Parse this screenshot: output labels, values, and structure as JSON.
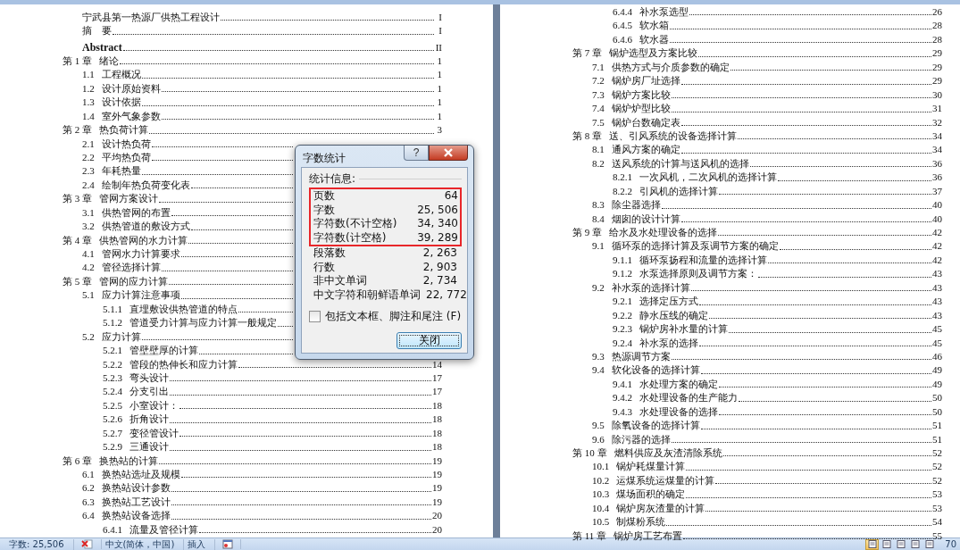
{
  "pages": [
    {
      "entries": [
        {
          "kind": "front",
          "title": "宁武县第一热源厂供热工程设计",
          "page": "I"
        },
        {
          "kind": "front",
          "title": "摘　要",
          "page": "I"
        },
        {
          "kind": "abstract",
          "title": "Abstract",
          "page": "II"
        },
        {
          "kind": "chapter",
          "number": "第 1 章",
          "title": "绪论",
          "page": "1",
          "children": [
            {
              "number": "1.1",
              "title": "工程概况",
              "page": "1"
            },
            {
              "number": "1.2",
              "title": "设计原始资料",
              "page": "1"
            },
            {
              "number": "1.3",
              "title": "设计依据",
              "page": "1"
            },
            {
              "number": "1.4",
              "title": "室外气象参数",
              "page": "1"
            }
          ]
        },
        {
          "kind": "chapter",
          "number": "第 2 章",
          "title": "热负荷计算",
          "page": "3",
          "children": [
            {
              "number": "2.1",
              "title": "设计热负荷"
            },
            {
              "number": "2.2",
              "title": "平均热负荷"
            },
            {
              "number": "2.3",
              "title": "年耗热量"
            },
            {
              "number": "2.4",
              "title": "绘制年热负荷变化表"
            }
          ]
        },
        {
          "kind": "chapter",
          "number": "第 3 章",
          "title": "管网方案设计",
          "children": [
            {
              "number": "3.1",
              "title": "供热管网的布置"
            },
            {
              "number": "3.2",
              "title": "供热管道的敷设方式"
            }
          ]
        },
        {
          "kind": "chapter",
          "number": "第 4 章",
          "title": "供热管网的水力计算",
          "children": [
            {
              "number": "4.1",
              "title": "管网水力计算要求"
            },
            {
              "number": "4.2",
              "title": "管径选择计算"
            }
          ]
        },
        {
          "kind": "chapter",
          "number": "第 5 章",
          "title": "管网的应力计算",
          "children": [
            {
              "number": "5.1",
              "title": "应力计算注意事项",
              "children": [
                {
                  "number": "5.1.1",
                  "title": "直埋敷设供热管道的特点"
                },
                {
                  "number": "5.1.2",
                  "title": "管道受力计算与应力计算一般规定"
                }
              ]
            },
            {
              "number": "5.2",
              "title": "应力计算",
              "children": [
                {
                  "number": "5.2.1",
                  "title": "管壁壁厚的计算"
                },
                {
                  "number": "5.2.2",
                  "title": "管段的热伸长和应力计算",
                  "page": "14"
                },
                {
                  "number": "5.2.3",
                  "title": "弯头设计",
                  "page": "17"
                },
                {
                  "number": "5.2.4",
                  "title": "分支引出",
                  "page": "17"
                },
                {
                  "number": "5.2.5",
                  "title": "小室设计：",
                  "page": "18"
                },
                {
                  "number": "5.2.6",
                  "title": "折角设计",
                  "page": "18"
                },
                {
                  "number": "5.2.7",
                  "title": "变径管设计",
                  "page": "18"
                },
                {
                  "number": "5.2.9",
                  "title": "三通设计",
                  "page": "18"
                }
              ]
            }
          ]
        },
        {
          "kind": "chapter",
          "number": "第 6 章",
          "title": "换热站的计算",
          "page": "19",
          "children": [
            {
              "number": "6.1",
              "title": "换热站选址及规模",
              "page": "19"
            },
            {
              "number": "6.2",
              "title": "换热站设计参数",
              "page": "19"
            },
            {
              "number": "6.3",
              "title": "换热站工艺设计",
              "page": "19"
            },
            {
              "number": "6.4",
              "title": "换热站设备选择",
              "page": "20",
              "children": [
                {
                  "number": "6.4.1",
                  "title": "流量及管径计算",
                  "page": "20"
                }
              ]
            }
          ]
        }
      ]
    },
    {
      "entries": [
        {
          "kind": "continued",
          "children": [
            {
              "children": [
                {
                  "number": "6.4.4",
                  "title": "补水泵选型",
                  "page": "26"
                },
                {
                  "number": "6.4.5",
                  "title": "软水箱",
                  "page": "28"
                },
                {
                  "number": "6.4.6",
                  "title": "软水器",
                  "page": "28"
                }
              ]
            }
          ]
        },
        {
          "kind": "chapter",
          "number": "第 7 章",
          "title": "锅炉选型及方案比较",
          "page": "29",
          "children": [
            {
              "number": "7.1",
              "title": "供热方式与介质参数的确定",
              "page": "29"
            },
            {
              "number": "7.2",
              "title": "锅炉房厂址选择",
              "page": "29"
            },
            {
              "number": "7.3",
              "title": "锅炉方案比较",
              "page": "30"
            },
            {
              "number": "7.4",
              "title": "锅炉炉型比较",
              "page": "31"
            },
            {
              "number": "7.5",
              "title": "锅炉台数确定表",
              "page": "32"
            }
          ]
        },
        {
          "kind": "chapter",
          "number": "第 8 章",
          "title": "送、引风系统的设备选择计算",
          "page": "34",
          "children": [
            {
              "number": "8.1",
              "title": "通风方案的确定",
              "page": "34"
            },
            {
              "number": "8.2",
              "title": "送风系统的计算与送风机的选择",
              "page": "36",
              "children": [
                {
                  "number": "8.2.1",
                  "title": "一次风机，二次风机的选择计算",
                  "page": "36"
                },
                {
                  "number": "8.2.2",
                  "title": "引风机的选择计算",
                  "page": "37"
                }
              ]
            },
            {
              "number": "8.3",
              "title": "除尘器选择",
              "page": "40"
            },
            {
              "number": "8.4",
              "title": "烟囱的设计计算",
              "page": "40"
            }
          ]
        },
        {
          "kind": "chapter",
          "number": "第 9 章",
          "title": "给水及水处理设备的选择",
          "page": "42",
          "children": [
            {
              "number": "9.1",
              "title": "循环泵的选择计算及泵调节方案的确定",
              "page": "42",
              "children": [
                {
                  "number": "9.1.1",
                  "title": "循环泵扬程和流量的选择计算",
                  "page": "42"
                },
                {
                  "number": "9.1.2",
                  "title": "水泵选择原则及调节方案：",
                  "page": "43"
                }
              ]
            },
            {
              "number": "9.2",
              "title": "补水泵的选择计算",
              "page": "43",
              "children": [
                {
                  "number": "9.2.1",
                  "title": "选择定压方式",
                  "page": "43"
                },
                {
                  "number": "9.2.2",
                  "title": "静水压线的确定",
                  "page": "43"
                },
                {
                  "number": "9.2.3",
                  "title": "锅炉房补水量的计算",
                  "page": "45"
                },
                {
                  "number": "9.2.4",
                  "title": "补水泵的选择",
                  "page": "45"
                }
              ]
            },
            {
              "number": "9.3",
              "title": "热源调节方案",
              "page": "46"
            },
            {
              "number": "9.4",
              "title": "软化设备的选择计算",
              "page": "49",
              "children": [
                {
                  "number": "9.4.1",
                  "title": "水处理方案的确定",
                  "page": "49"
                },
                {
                  "number": "9.4.2",
                  "title": "水处理设备的生产能力",
                  "page": "50"
                },
                {
                  "number": "9.4.3",
                  "title": "水处理设备的选择",
                  "page": "50"
                }
              ]
            },
            {
              "number": "9.5",
              "title": "除氧设备的选择计算",
              "page": "51"
            },
            {
              "number": "9.6",
              "title": "除污器的选择",
              "page": "51"
            }
          ]
        },
        {
          "kind": "chapter",
          "number": "第 10 章",
          "title": "燃料供应及灰渣清除系统",
          "page": "52",
          "children": [
            {
              "number": "10.1",
              "title": "锅炉耗煤量计算",
              "page": "52"
            },
            {
              "number": "10.2",
              "title": "运煤系统运煤量的计算",
              "page": "52"
            },
            {
              "number": "10.3",
              "title": "煤场面积的确定",
              "page": "53"
            },
            {
              "number": "10.4",
              "title": "锅炉房灰渣量的计算",
              "page": "53"
            },
            {
              "number": "10.5",
              "title": "制煤粉系统",
              "page": "54"
            }
          ]
        },
        {
          "kind": "chapter",
          "number": "第 11 章",
          "title": "锅炉房工艺布置",
          "page": "55"
        }
      ]
    }
  ],
  "dialog": {
    "title": "字数统计",
    "help_button": "?",
    "group_label": "统计信息:",
    "stats": [
      {
        "label": "页数",
        "value": "64",
        "highlighted": true
      },
      {
        "label": "字数",
        "value": "25, 506",
        "highlighted": true
      },
      {
        "label": "字符数(不计空格)",
        "value": "34, 340",
        "highlighted": true
      },
      {
        "label": "字符数(计空格)",
        "value": "39, 289",
        "highlighted": true
      },
      {
        "label": "段落数",
        "value": "2, 263",
        "highlighted": false
      },
      {
        "label": "行数",
        "value": "2, 903",
        "highlighted": false
      },
      {
        "label": "非中文单词",
        "value": "2, 734",
        "highlighted": false
      },
      {
        "label": "中文字符和朝鲜语单词",
        "value": "22, 772",
        "highlighted": false
      }
    ],
    "checkbox": {
      "label": "包括文本框、脚注和尾注 (F)",
      "checked": false
    },
    "close_button": "关闭"
  },
  "status_bar": {
    "word_count": "字数: 25,506",
    "language": "中文(简体，中国)",
    "mode": "插入",
    "views": [
      {
        "selected": true
      },
      {
        "selected": false
      },
      {
        "selected": false
      },
      {
        "selected": false
      },
      {
        "selected": false
      }
    ],
    "zoom": "70"
  }
}
